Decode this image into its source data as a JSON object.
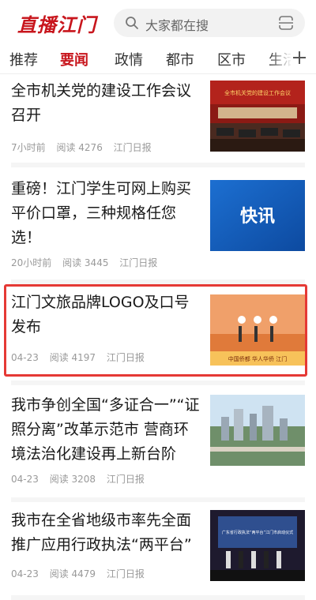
{
  "header": {
    "logo_text": "直播江门",
    "search_placeholder": "大家都在搜",
    "search_icon": "search-icon",
    "scan_icon": "scan-icon",
    "brand_color": "#c8161d"
  },
  "tabs": [
    {
      "label": "推荐",
      "active": false
    },
    {
      "label": "要闻",
      "active": true
    },
    {
      "label": "政情",
      "active": false
    },
    {
      "label": "都市",
      "active": false
    },
    {
      "label": "区市",
      "active": false
    },
    {
      "label": "生活",
      "active": false
    }
  ],
  "tabs_add_icon": "plus-icon",
  "articles": [
    {
      "title": "全市机关党的建设工作会议召开",
      "time": "7小时前",
      "reads": "阅读 4276",
      "source": "江门日报",
      "thumb_caption": "全市机关党的建设工作会议"
    },
    {
      "title": "重磅！江门学生可网上购买平价口罩，三种规格任您选！",
      "time": "20小时前",
      "reads": "阅读 3445",
      "source": "江门日报",
      "thumb_caption": "快讯"
    },
    {
      "title": "江门文旅品牌LOGO及口号发布",
      "time": "04-23",
      "reads": "阅读 4197",
      "source": "江门日报",
      "thumb_caption": "中国侨都 华人华侨 江门"
    },
    {
      "title": "我市争创全国“多证合一”“证照分离”改革示范市 营商环境法治化建设再上新台阶",
      "time": "04-23",
      "reads": "阅读 3208",
      "source": "江门日报",
      "thumb_caption": ""
    },
    {
      "title": "我市在全省地级市率先全面推广应用行政执法“两平台”",
      "time": "04-23",
      "reads": "阅读 4479",
      "source": "江门日报",
      "thumb_caption": "广东省行政执法“两平台”江门市启动仪式"
    }
  ]
}
